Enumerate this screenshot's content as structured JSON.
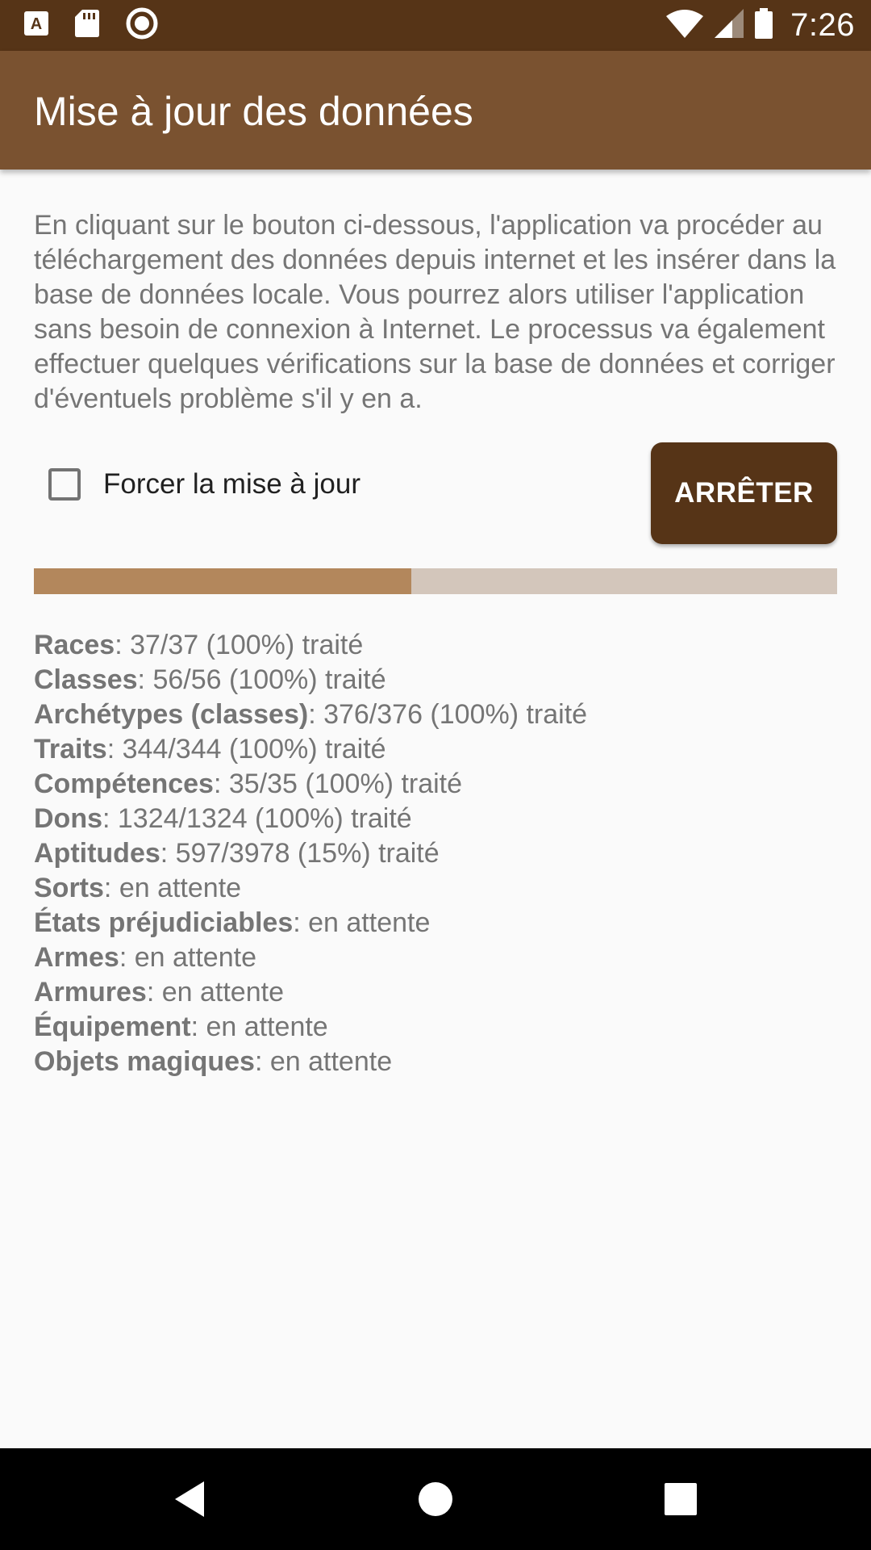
{
  "status_bar": {
    "left_icons": [
      "font-download-icon",
      "sd-card-icon",
      "record-icon"
    ],
    "right_icons": [
      "wifi-icon",
      "cellular-signal-icon",
      "battery-icon"
    ],
    "time": "7:26"
  },
  "app_bar": {
    "title": "Mise à jour des données"
  },
  "description": "En cliquant sur le bouton ci-dessous, l'application va procéder au téléchargement des données depuis internet et les insérer dans la base de données locale. Vous pourrez alors utiliser l'application sans besoin de connexion à Internet. Le processus va également effectuer quelques vérifications sur la base de données et corriger d'éventuels problème s'il y en a.",
  "force_update": {
    "label": "Forcer la mise à jour",
    "checked": false
  },
  "stop_button": {
    "label": "ARRÊTER"
  },
  "progress": {
    "fraction": 0.47
  },
  "status_items": [
    {
      "name": "Races",
      "status": ": 37/37 (100%) traité"
    },
    {
      "name": "Classes",
      "status": ": 56/56 (100%) traité"
    },
    {
      "name": "Archétypes (classes)",
      "status": ": 376/376 (100%) traité"
    },
    {
      "name": "Traits",
      "status": ": 344/344 (100%) traité"
    },
    {
      "name": "Compétences",
      "status": ": 35/35 (100%) traité"
    },
    {
      "name": "Dons",
      "status": ": 1324/1324 (100%) traité"
    },
    {
      "name": "Aptitudes",
      "status": ": 597/3978 (15%) traité"
    },
    {
      "name": "Sorts",
      "status": ": en attente"
    },
    {
      "name": "États préjudiciables",
      "status": ": en attente"
    },
    {
      "name": "Armes",
      "status": ": en attente"
    },
    {
      "name": "Armures",
      "status": ": en attente"
    },
    {
      "name": "Équipement",
      "status": ": en attente"
    },
    {
      "name": "Objets magiques",
      "status": ": en attente"
    }
  ],
  "nav_bar": {
    "buttons": [
      "back-icon",
      "home-icon",
      "recents-icon"
    ]
  },
  "colors": {
    "status_bar": "#563417",
    "app_bar": "#7a5230",
    "button": "#563417",
    "progress_fill": "#b3875c",
    "progress_track": "#d3c6bb",
    "background": "#fafafa",
    "body_text": "#757575"
  }
}
